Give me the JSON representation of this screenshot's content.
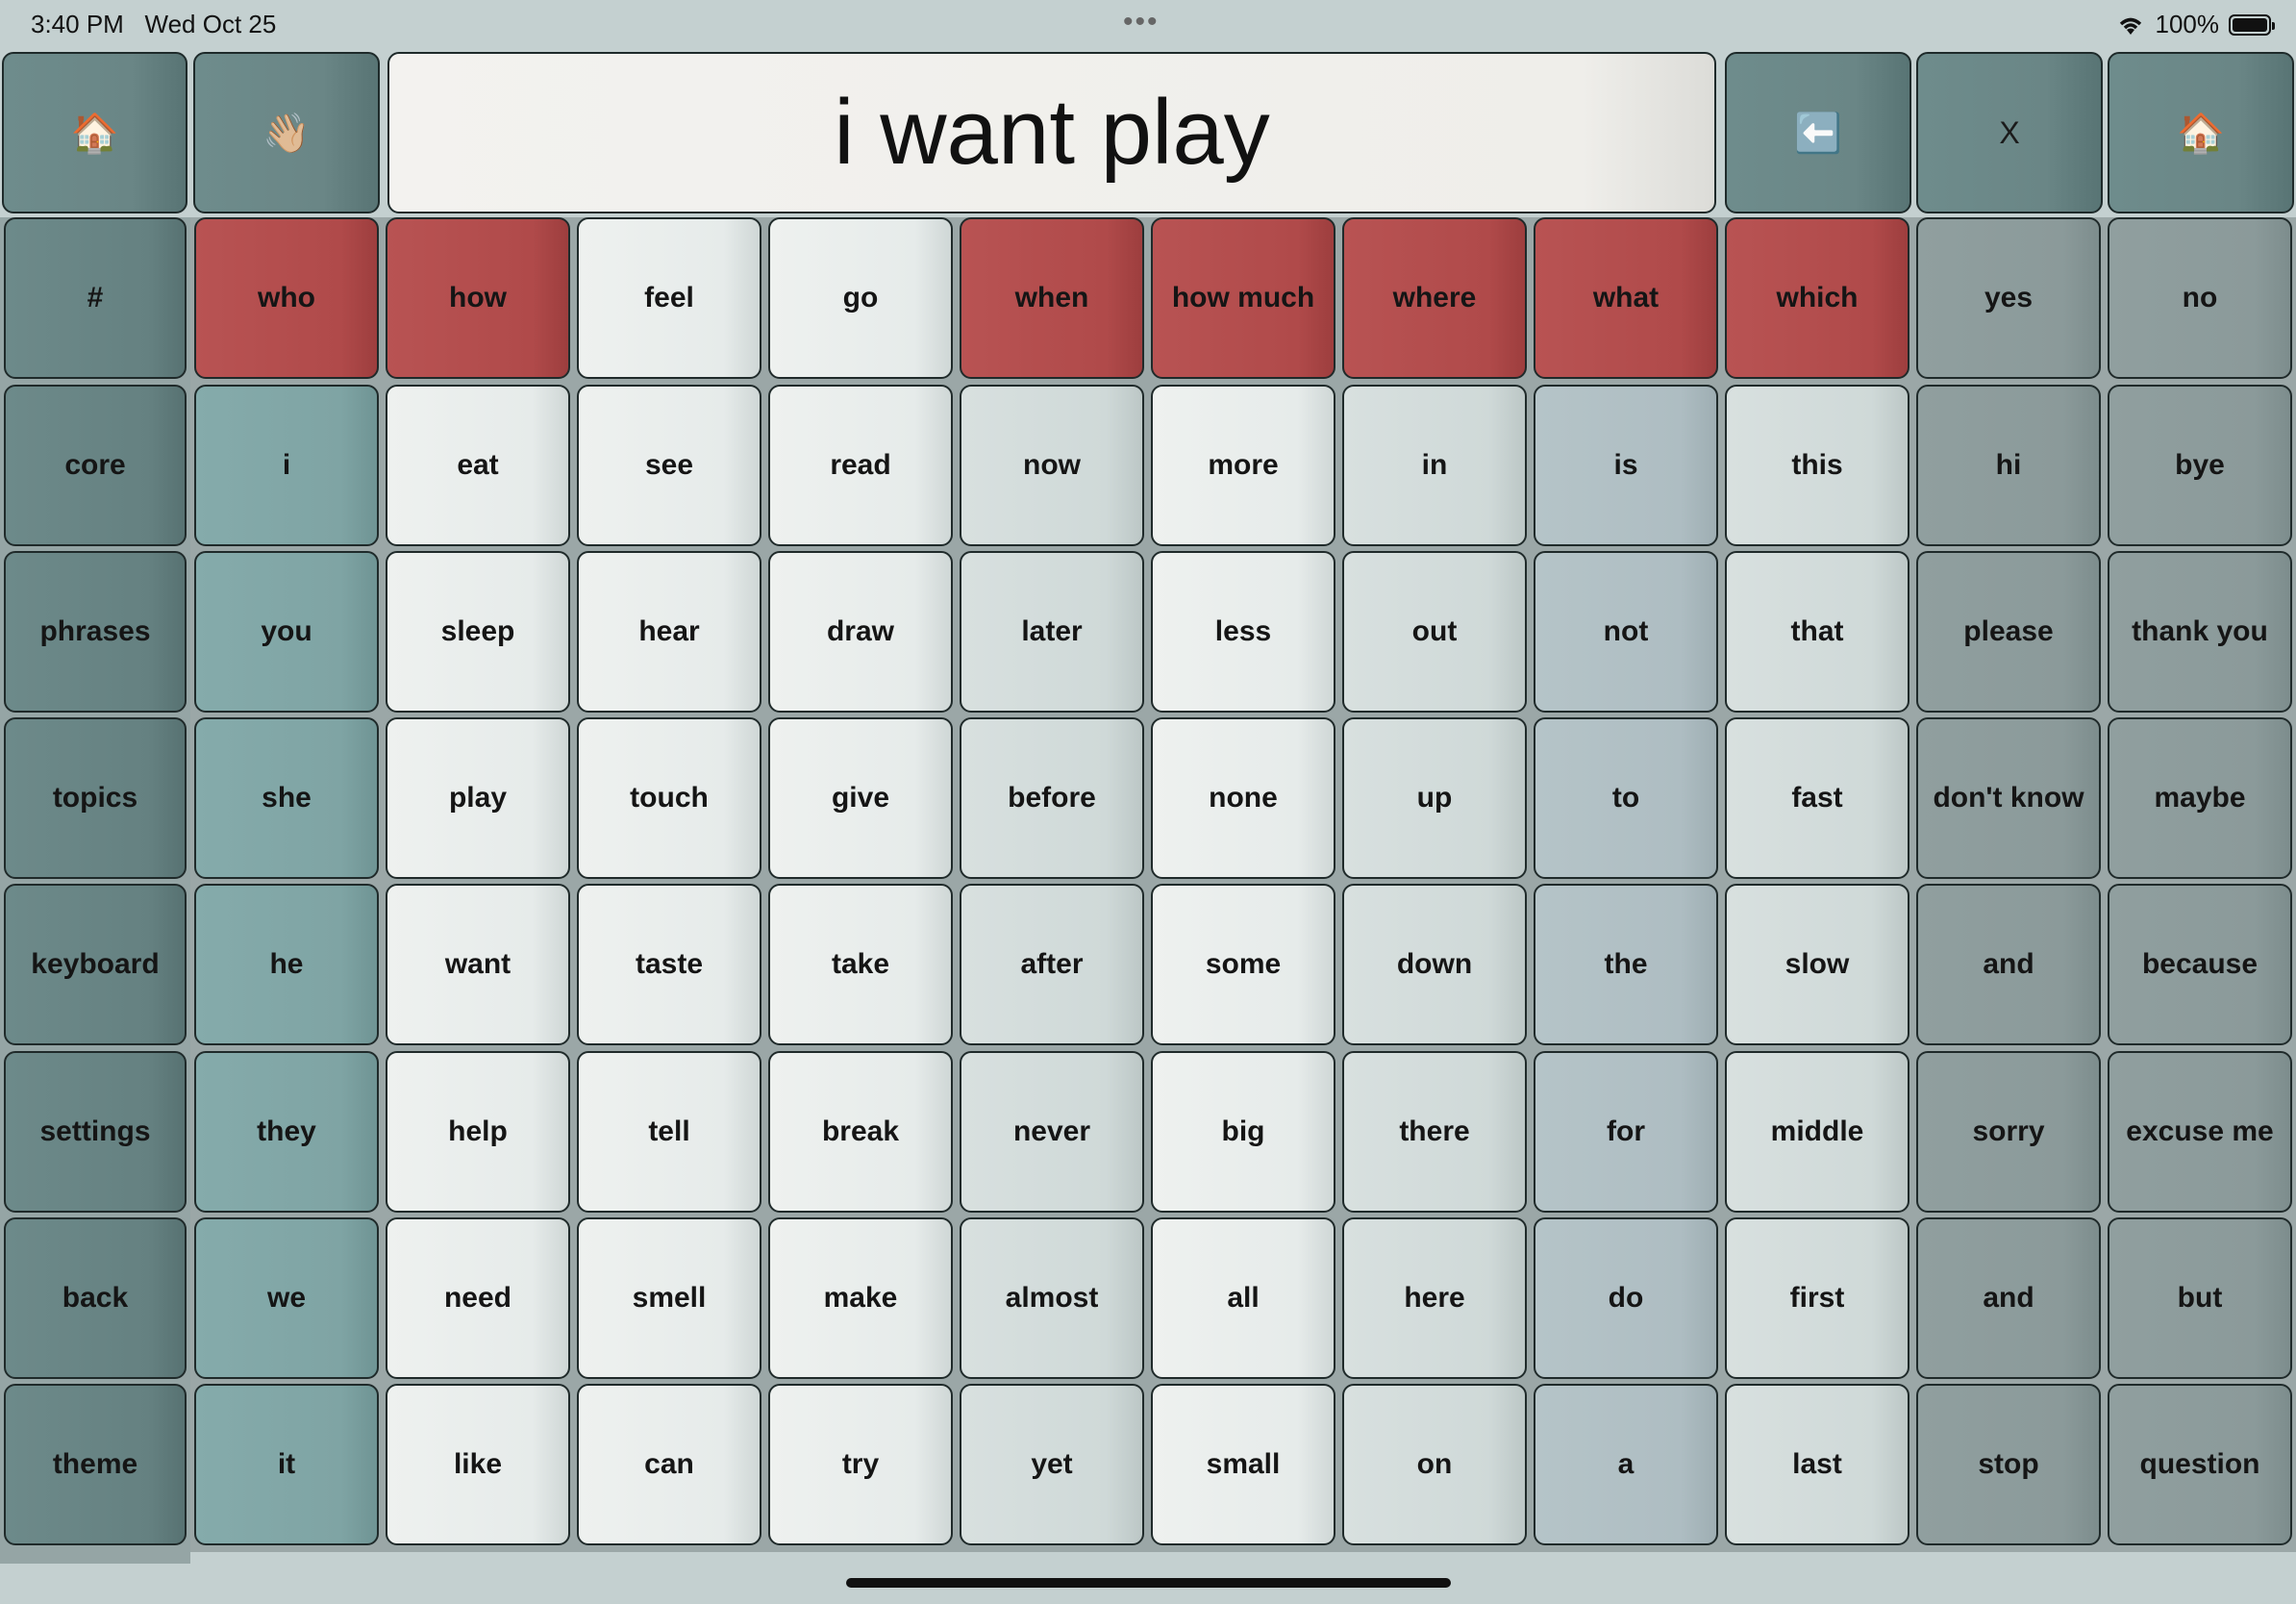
{
  "status_bar": {
    "time": "3:40 PM",
    "date": "Wed Oct 25",
    "battery": "100%"
  },
  "top_row": [
    {
      "name": "home-button-left",
      "icon": "🏠"
    },
    {
      "name": "wave-button",
      "icon": "👋🏼"
    }
  ],
  "message": "i want play",
  "top_right": [
    {
      "name": "backspace-button",
      "icon": "⬅️"
    },
    {
      "name": "clear-button",
      "icon": "X"
    },
    {
      "name": "home-button-right",
      "icon": "🏠"
    }
  ],
  "sidebar": [
    "#",
    "core",
    "phrases",
    "topics",
    "keyboard",
    "settings",
    "back",
    "theme"
  ],
  "grid": [
    [
      "who",
      "how",
      "feel",
      "go",
      "when",
      "how much",
      "where",
      "what",
      "which",
      "yes",
      "no"
    ],
    [
      "i",
      "eat",
      "see",
      "read",
      "now",
      "more",
      "in",
      "is",
      "this",
      "hi",
      "bye"
    ],
    [
      "you",
      "sleep",
      "hear",
      "draw",
      "later",
      "less",
      "out",
      "not",
      "that",
      "please",
      "thank you"
    ],
    [
      "she",
      "play",
      "touch",
      "give",
      "before",
      "none",
      "up",
      "to",
      "fast",
      "don't know",
      "maybe"
    ],
    [
      "he",
      "want",
      "taste",
      "take",
      "after",
      "some",
      "down",
      "the",
      "slow",
      "and",
      "because"
    ],
    [
      "they",
      "help",
      "tell",
      "break",
      "never",
      "big",
      "there",
      "for",
      "middle",
      "sorry",
      "excuse me"
    ],
    [
      "we",
      "need",
      "smell",
      "make",
      "almost",
      "all",
      "here",
      "do",
      "first",
      "and",
      "but"
    ],
    [
      "it",
      "like",
      "can",
      "try",
      "yet",
      "small",
      "on",
      "a",
      "last",
      "stop",
      "question"
    ]
  ],
  "first_row_colors": [
    "red",
    "red",
    "white",
    "white",
    "red",
    "red",
    "red",
    "red",
    "red",
    "gray",
    "gray"
  ],
  "column_colors": [
    "teal",
    "white",
    "white",
    "white",
    "light",
    "white",
    "light",
    "blue",
    "light",
    "gray",
    "gray"
  ]
}
